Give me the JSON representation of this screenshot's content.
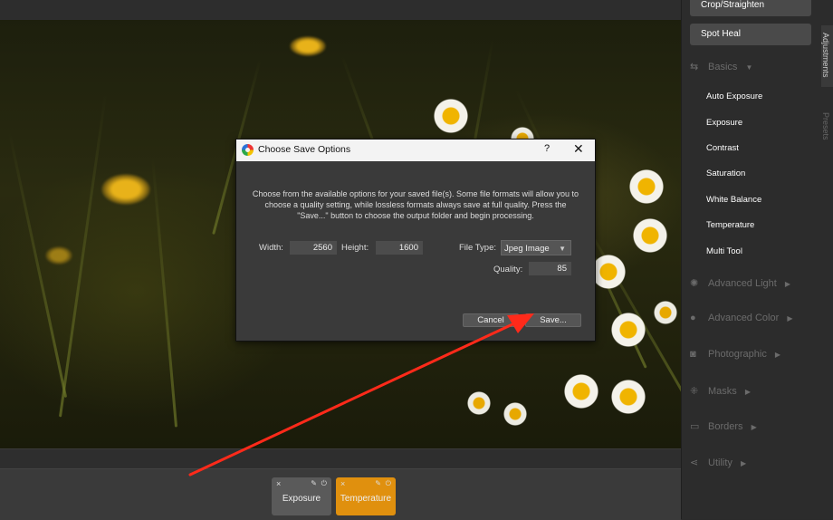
{
  "panel": {
    "buttons": {
      "crop": "Crop/Straighten",
      "spot_heal": "Spot Heal"
    },
    "tabs": {
      "adjustments": "Adjustments",
      "presets": "Presets"
    },
    "basics": {
      "label": "Basics",
      "items": [
        "Auto Exposure",
        "Exposure",
        "Contrast",
        "Saturation",
        "White Balance",
        "Temperature",
        "Multi Tool"
      ]
    },
    "sections": [
      "Advanced Light",
      "Advanced Color",
      "Photographic",
      "Masks",
      "Borders",
      "Utility"
    ]
  },
  "dialog": {
    "title": "Choose Save Options",
    "help": "?",
    "close": "✕",
    "description": "Choose from the available options for your saved file(s). Some file formats will allow you to choose a quality setting, while lossless formats always save at full quality. Press the \"Save...\" button to choose the output folder and begin processing.",
    "width_label": "Width:",
    "width_value": "2560",
    "height_label": "Height:",
    "height_value": "1600",
    "filetype_label": "File Type:",
    "filetype_value": "Jpeg Image",
    "quality_label": "Quality:",
    "quality_value": "85",
    "cancel": "Cancel",
    "save": "Save..."
  },
  "chips": [
    {
      "label": "Exposure",
      "color": "#5a5a5a"
    },
    {
      "label": "Temperature",
      "color": "#e0900e"
    }
  ],
  "chip_icons": {
    "close": "×",
    "pin": "✎",
    "power": "⏻"
  },
  "annotation_color": "#ff2a1a"
}
